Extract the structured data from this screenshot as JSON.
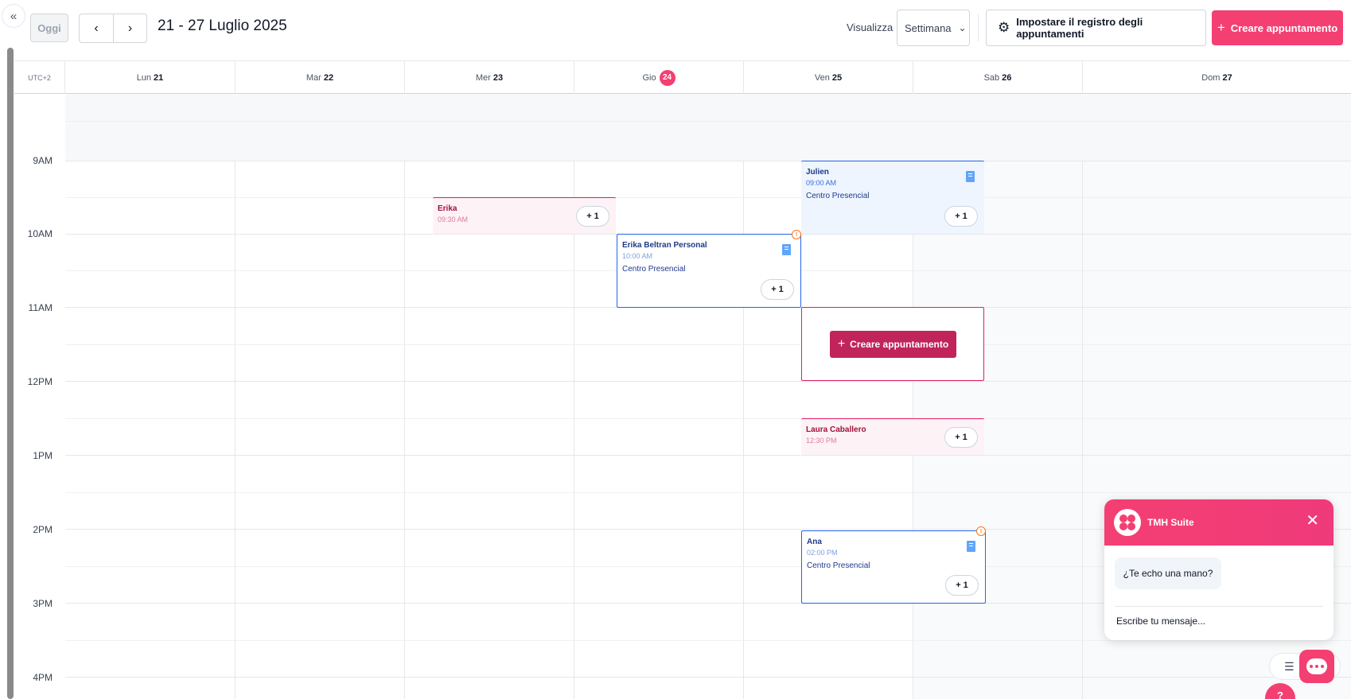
{
  "header": {
    "today_label": "Oggi",
    "prev_icon": "chevron-left-icon",
    "next_icon": "chevron-right-icon",
    "date_range": "21 - 27 Luglio 2025",
    "view_label": "Visualizza",
    "view_selected": "Settimana",
    "settings_label": "Impostare il registro degli appuntamenti",
    "create_label": "Creare appuntamento",
    "accent": "#f43f72"
  },
  "calendar": {
    "timezone": "UTC+2",
    "days": [
      {
        "weekday": "Lun",
        "day": "21"
      },
      {
        "weekday": "Mar",
        "day": "22"
      },
      {
        "weekday": "Mer",
        "day": "23"
      },
      {
        "weekday": "Gio",
        "day": "24"
      },
      {
        "weekday": "Ven",
        "day": "25"
      },
      {
        "weekday": "Sab",
        "day": "26"
      },
      {
        "weekday": "Dom",
        "day": "27"
      }
    ],
    "hours": [
      "9AM",
      "10AM",
      "11AM",
      "12PM",
      "1PM",
      "2PM",
      "3PM",
      "4PM"
    ],
    "events": [
      {
        "name": "Erika",
        "time": "09:30 AM",
        "more": "+ 1"
      },
      {
        "name": "Julien",
        "time": "09:00 AM",
        "location": "Centro Presencial",
        "more": "+ 1"
      },
      {
        "name": "Erika Beltran Personal",
        "time": "10:00 AM",
        "location": "Centro Presencial",
        "more": "+ 1"
      },
      {
        "name": "Laura Caballero",
        "time": "12:30 PM",
        "more": "+ 1"
      },
      {
        "name": "Ana",
        "time": "02:00 PM",
        "location": "Centro Presencial",
        "more": "+ 1"
      }
    ],
    "slot_create_label": "Creare appuntamento"
  },
  "chat": {
    "title": "TMH Suite",
    "message": "¿Te echo una mano?",
    "input_placeholder": "Escribe tu mensaje...",
    "help_label": "?"
  }
}
